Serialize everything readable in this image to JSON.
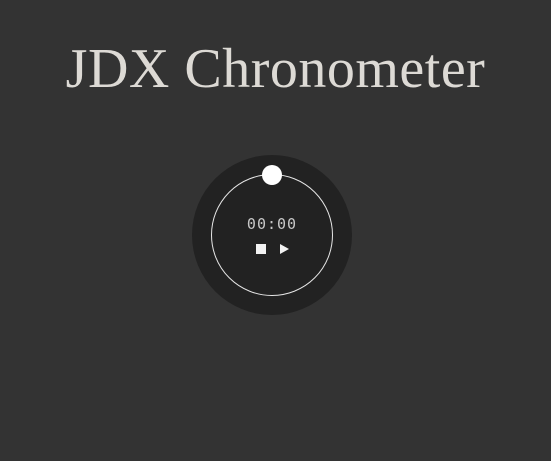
{
  "app": {
    "title": "JDX Chronometer"
  },
  "chronometer": {
    "time": "00:00",
    "controls": {
      "stop_icon": "stop-icon",
      "play_icon": "play-icon"
    },
    "colors": {
      "background": "#333333",
      "dial": "#222222",
      "ring": "#e6e6e6",
      "knob": "#ffffff",
      "title": "#dddad5"
    }
  }
}
